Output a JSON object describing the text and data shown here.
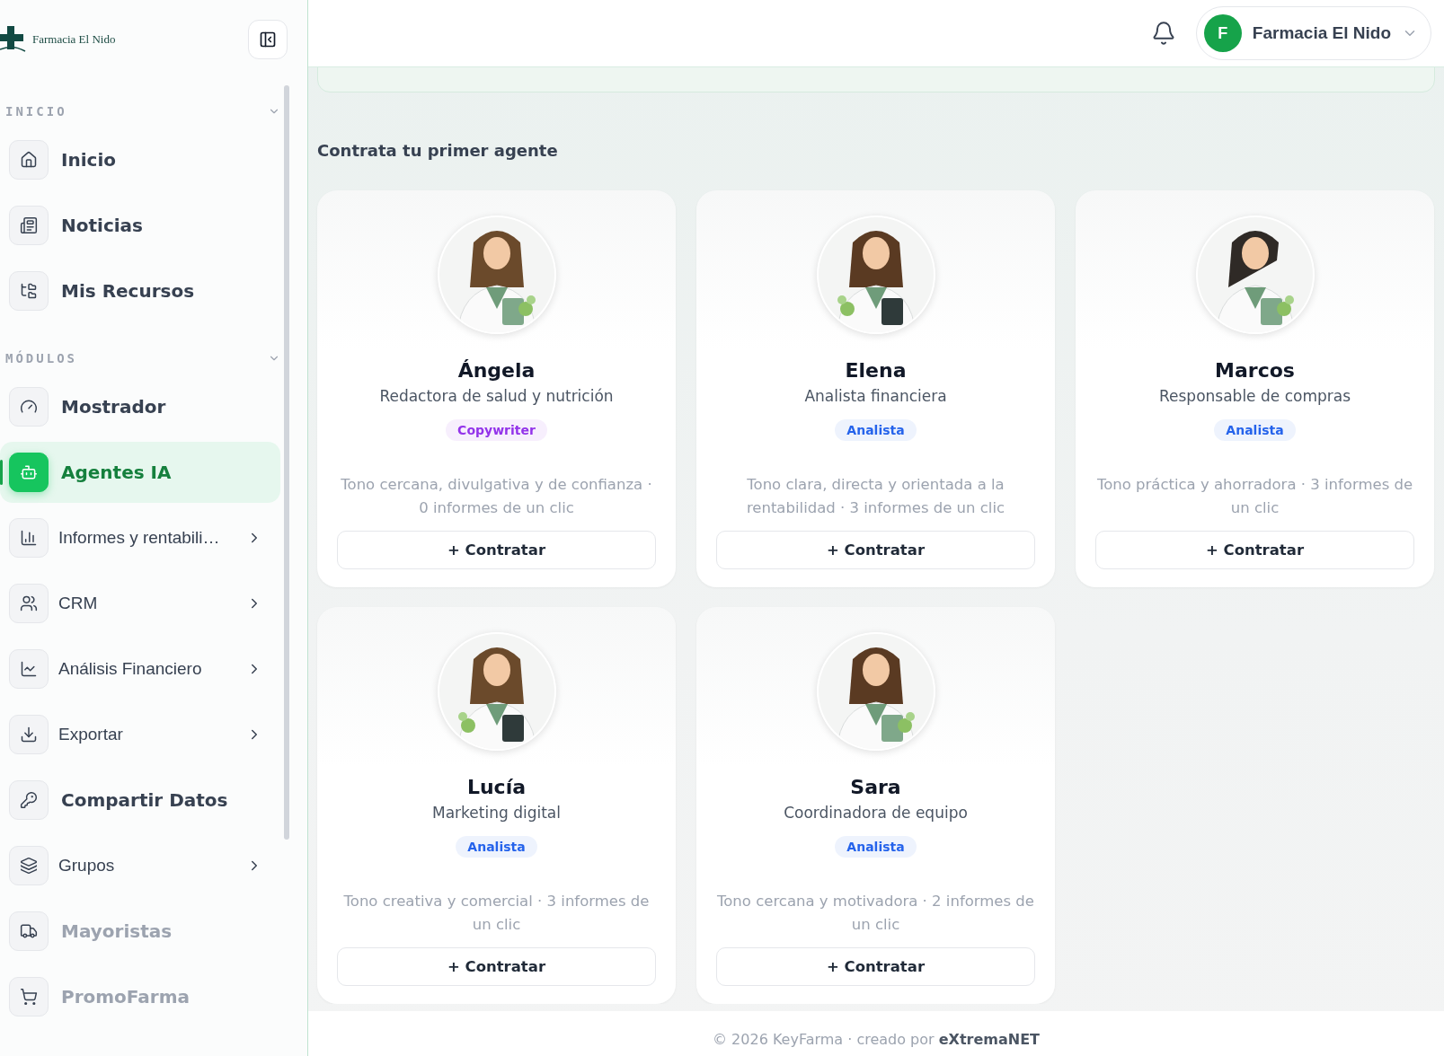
{
  "logo": {
    "text": "Farmacia El Nido"
  },
  "sidebar": {
    "sections": [
      {
        "title": "INICIO",
        "expanded": true,
        "items": [
          {
            "label": "Inicio",
            "kind": "link",
            "selected": false,
            "disabled": false
          },
          {
            "label": "Noticias",
            "kind": "link",
            "selected": false,
            "disabled": false
          },
          {
            "label": "Mis Recursos",
            "kind": "link",
            "selected": false,
            "disabled": false
          }
        ]
      },
      {
        "title": "MÓDULOS",
        "expanded": true,
        "items": [
          {
            "label": "Mostrador",
            "kind": "link",
            "selected": false,
            "disabled": false
          },
          {
            "label": "Agentes IA",
            "kind": "link",
            "selected": true,
            "disabled": false
          },
          {
            "label": "Informes y rentabili…",
            "kind": "group",
            "selected": false,
            "disabled": false
          },
          {
            "label": "CRM",
            "kind": "group",
            "selected": false,
            "disabled": false
          },
          {
            "label": "Análisis Financiero",
            "kind": "group",
            "selected": false,
            "disabled": false
          },
          {
            "label": "Exportar",
            "kind": "group",
            "selected": false,
            "disabled": false
          },
          {
            "label": "Compartir Datos",
            "kind": "link",
            "selected": false,
            "disabled": false
          },
          {
            "label": "Grupos",
            "kind": "group",
            "selected": false,
            "disabled": false
          },
          {
            "label": "Mayoristas",
            "kind": "link",
            "selected": false,
            "disabled": true
          },
          {
            "label": "PromoFarma",
            "kind": "link",
            "selected": false,
            "disabled": true
          }
        ]
      }
    ]
  },
  "header": {
    "account": {
      "initial": "F",
      "name": "Farmacia El Nido"
    }
  },
  "section_title": "Contrata tu primer agente",
  "agents": [
    {
      "name": "Ángela",
      "role": "Redactora de salud y nutrición",
      "tag": "Copywriter",
      "color": "#9333ea",
      "description": "Tono cercana, divulgativa y de confianza · 0 informes de un clic",
      "button": "+ Contratar"
    },
    {
      "name": "Elena",
      "role": "Analista financiera",
      "tag": "Analista",
      "color": "#2563eb",
      "description": "Tono clara, directa y orientada a la rentabilidad · 3 informes de un clic",
      "button": "+ Contratar"
    },
    {
      "name": "Marcos",
      "role": "Responsable de compras",
      "tag": "Analista",
      "color": "#2563eb",
      "description": "Tono práctica y ahorradora · 3 informes de un clic",
      "button": "+ Contratar"
    },
    {
      "name": "Lucía",
      "role": "Marketing digital",
      "tag": "Analista",
      "color": "#2563eb",
      "description": "Tono creativa y comercial · 3 informes de un clic",
      "button": "+ Contratar"
    },
    {
      "name": "Sara",
      "role": "Coordinadora de equipo",
      "tag": "Analista",
      "color": "#2563eb",
      "description": "Tono cercana y motivadora · 2 informes de un clic",
      "button": "+ Contratar"
    }
  ],
  "footer": {
    "text": "© 2026 KeyFarma · creado por **eXtremaNET**"
  }
}
